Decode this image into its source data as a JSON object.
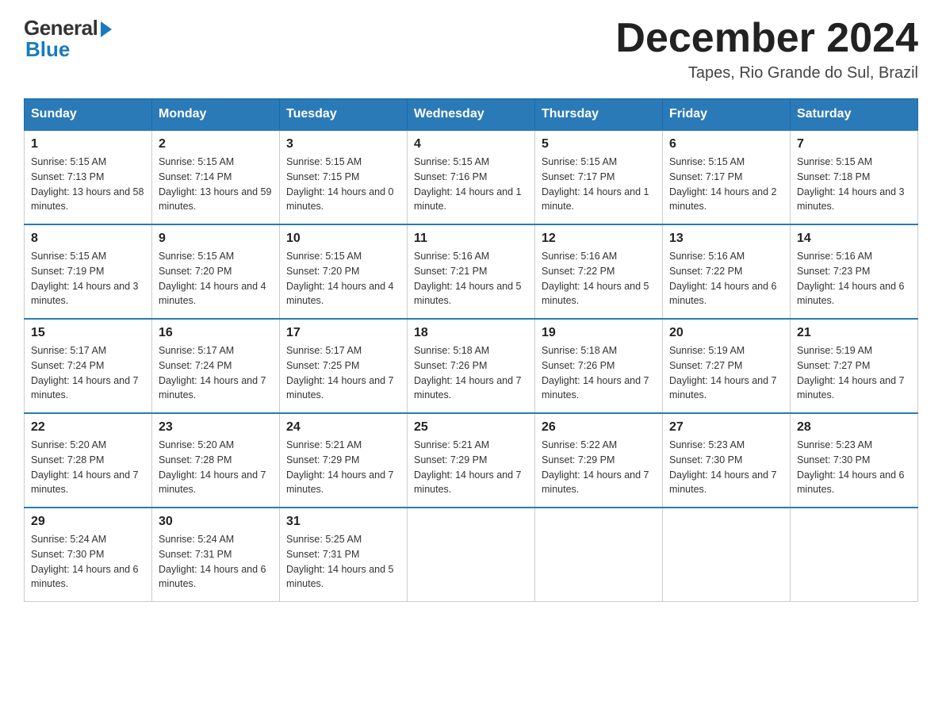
{
  "logo": {
    "general": "General",
    "blue": "Blue"
  },
  "title": {
    "month": "December 2024",
    "location": "Tapes, Rio Grande do Sul, Brazil"
  },
  "headers": [
    "Sunday",
    "Monday",
    "Tuesday",
    "Wednesday",
    "Thursday",
    "Friday",
    "Saturday"
  ],
  "weeks": [
    [
      {
        "day": "1",
        "sunrise": "5:15 AM",
        "sunset": "7:13 PM",
        "daylight": "13 hours and 58 minutes."
      },
      {
        "day": "2",
        "sunrise": "5:15 AM",
        "sunset": "7:14 PM",
        "daylight": "13 hours and 59 minutes."
      },
      {
        "day": "3",
        "sunrise": "5:15 AM",
        "sunset": "7:15 PM",
        "daylight": "14 hours and 0 minutes."
      },
      {
        "day": "4",
        "sunrise": "5:15 AM",
        "sunset": "7:16 PM",
        "daylight": "14 hours and 1 minute."
      },
      {
        "day": "5",
        "sunrise": "5:15 AM",
        "sunset": "7:17 PM",
        "daylight": "14 hours and 1 minute."
      },
      {
        "day": "6",
        "sunrise": "5:15 AM",
        "sunset": "7:17 PM",
        "daylight": "14 hours and 2 minutes."
      },
      {
        "day": "7",
        "sunrise": "5:15 AM",
        "sunset": "7:18 PM",
        "daylight": "14 hours and 3 minutes."
      }
    ],
    [
      {
        "day": "8",
        "sunrise": "5:15 AM",
        "sunset": "7:19 PM",
        "daylight": "14 hours and 3 minutes."
      },
      {
        "day": "9",
        "sunrise": "5:15 AM",
        "sunset": "7:20 PM",
        "daylight": "14 hours and 4 minutes."
      },
      {
        "day": "10",
        "sunrise": "5:15 AM",
        "sunset": "7:20 PM",
        "daylight": "14 hours and 4 minutes."
      },
      {
        "day": "11",
        "sunrise": "5:16 AM",
        "sunset": "7:21 PM",
        "daylight": "14 hours and 5 minutes."
      },
      {
        "day": "12",
        "sunrise": "5:16 AM",
        "sunset": "7:22 PM",
        "daylight": "14 hours and 5 minutes."
      },
      {
        "day": "13",
        "sunrise": "5:16 AM",
        "sunset": "7:22 PM",
        "daylight": "14 hours and 6 minutes."
      },
      {
        "day": "14",
        "sunrise": "5:16 AM",
        "sunset": "7:23 PM",
        "daylight": "14 hours and 6 minutes."
      }
    ],
    [
      {
        "day": "15",
        "sunrise": "5:17 AM",
        "sunset": "7:24 PM",
        "daylight": "14 hours and 7 minutes."
      },
      {
        "day": "16",
        "sunrise": "5:17 AM",
        "sunset": "7:24 PM",
        "daylight": "14 hours and 7 minutes."
      },
      {
        "day": "17",
        "sunrise": "5:17 AM",
        "sunset": "7:25 PM",
        "daylight": "14 hours and 7 minutes."
      },
      {
        "day": "18",
        "sunrise": "5:18 AM",
        "sunset": "7:26 PM",
        "daylight": "14 hours and 7 minutes."
      },
      {
        "day": "19",
        "sunrise": "5:18 AM",
        "sunset": "7:26 PM",
        "daylight": "14 hours and 7 minutes."
      },
      {
        "day": "20",
        "sunrise": "5:19 AM",
        "sunset": "7:27 PM",
        "daylight": "14 hours and 7 minutes."
      },
      {
        "day": "21",
        "sunrise": "5:19 AM",
        "sunset": "7:27 PM",
        "daylight": "14 hours and 7 minutes."
      }
    ],
    [
      {
        "day": "22",
        "sunrise": "5:20 AM",
        "sunset": "7:28 PM",
        "daylight": "14 hours and 7 minutes."
      },
      {
        "day": "23",
        "sunrise": "5:20 AM",
        "sunset": "7:28 PM",
        "daylight": "14 hours and 7 minutes."
      },
      {
        "day": "24",
        "sunrise": "5:21 AM",
        "sunset": "7:29 PM",
        "daylight": "14 hours and 7 minutes."
      },
      {
        "day": "25",
        "sunrise": "5:21 AM",
        "sunset": "7:29 PM",
        "daylight": "14 hours and 7 minutes."
      },
      {
        "day": "26",
        "sunrise": "5:22 AM",
        "sunset": "7:29 PM",
        "daylight": "14 hours and 7 minutes."
      },
      {
        "day": "27",
        "sunrise": "5:23 AM",
        "sunset": "7:30 PM",
        "daylight": "14 hours and 7 minutes."
      },
      {
        "day": "28",
        "sunrise": "5:23 AM",
        "sunset": "7:30 PM",
        "daylight": "14 hours and 6 minutes."
      }
    ],
    [
      {
        "day": "29",
        "sunrise": "5:24 AM",
        "sunset": "7:30 PM",
        "daylight": "14 hours and 6 minutes."
      },
      {
        "day": "30",
        "sunrise": "5:24 AM",
        "sunset": "7:31 PM",
        "daylight": "14 hours and 6 minutes."
      },
      {
        "day": "31",
        "sunrise": "5:25 AM",
        "sunset": "7:31 PM",
        "daylight": "14 hours and 5 minutes."
      },
      null,
      null,
      null,
      null
    ]
  ],
  "labels": {
    "sunrise": "Sunrise:",
    "sunset": "Sunset:",
    "daylight": "Daylight:"
  }
}
